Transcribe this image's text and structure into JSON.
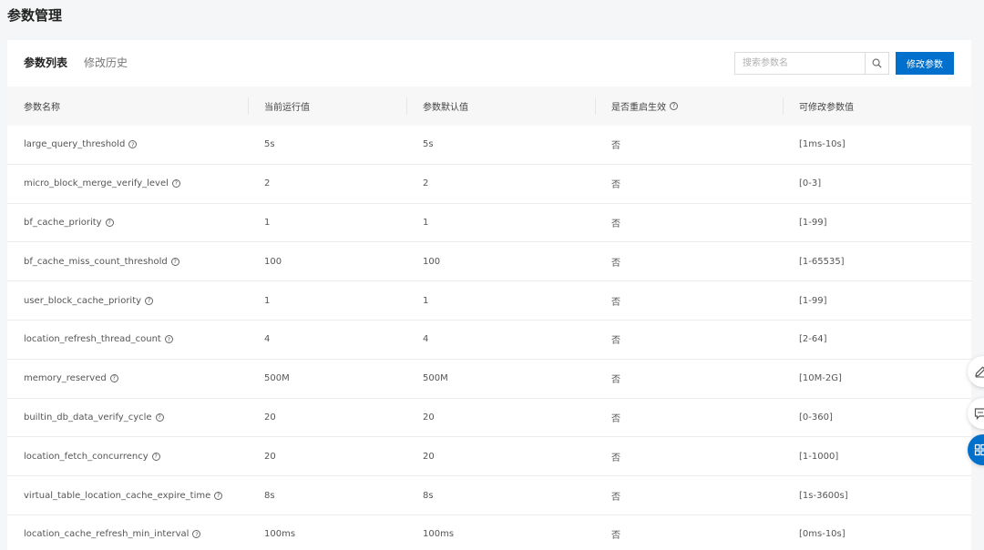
{
  "page": {
    "title": "参数管理"
  },
  "tabs": [
    {
      "label": "参数列表",
      "active": true
    },
    {
      "label": "修改历史",
      "active": false
    }
  ],
  "search": {
    "placeholder": "搜索参数名",
    "value": ""
  },
  "actions": {
    "modify_label": "修改参数"
  },
  "table": {
    "headers": [
      "参数名称",
      "当前运行值",
      "参数默认值",
      "是否重启生效",
      "可修改参数值"
    ],
    "rows": [
      {
        "name": "large_query_threshold",
        "current": "5s",
        "default": "5s",
        "restart": "否",
        "range": "[1ms-10s]"
      },
      {
        "name": "micro_block_merge_verify_level",
        "current": "2",
        "default": "2",
        "restart": "否",
        "range": "[0-3]"
      },
      {
        "name": "bf_cache_priority",
        "current": "1",
        "default": "1",
        "restart": "否",
        "range": "[1-99]"
      },
      {
        "name": "bf_cache_miss_count_threshold",
        "current": "100",
        "default": "100",
        "restart": "否",
        "range": "[1-65535]"
      },
      {
        "name": "user_block_cache_priority",
        "current": "1",
        "default": "1",
        "restart": "否",
        "range": "[1-99]"
      },
      {
        "name": "location_refresh_thread_count",
        "current": "4",
        "default": "4",
        "restart": "否",
        "range": "[2-64]"
      },
      {
        "name": "memory_reserved",
        "current": "500M",
        "default": "500M",
        "restart": "否",
        "range": "[10M-2G]"
      },
      {
        "name": "builtin_db_data_verify_cycle",
        "current": "20",
        "default": "20",
        "restart": "否",
        "range": "[0-360]"
      },
      {
        "name": "location_fetch_concurrency",
        "current": "20",
        "default": "20",
        "restart": "否",
        "range": "[1-1000]"
      },
      {
        "name": "virtual_table_location_cache_expire_time",
        "current": "8s",
        "default": "8s",
        "restart": "否",
        "range": "[1s-3600s]"
      },
      {
        "name": "location_cache_refresh_min_interval",
        "current": "100ms",
        "default": "100ms",
        "restart": "否",
        "range": "[0ms-10s]"
      }
    ]
  },
  "icons": {
    "help_glyph": "?"
  },
  "colors": {
    "primary": "#0070cc",
    "header_bg": "#f7f7f7",
    "page_bg": "#f5f6f7"
  },
  "floating_tools": [
    {
      "icon": "edit-icon"
    },
    {
      "icon": "feedback-icon"
    },
    {
      "icon": "apps-grid-icon"
    }
  ]
}
